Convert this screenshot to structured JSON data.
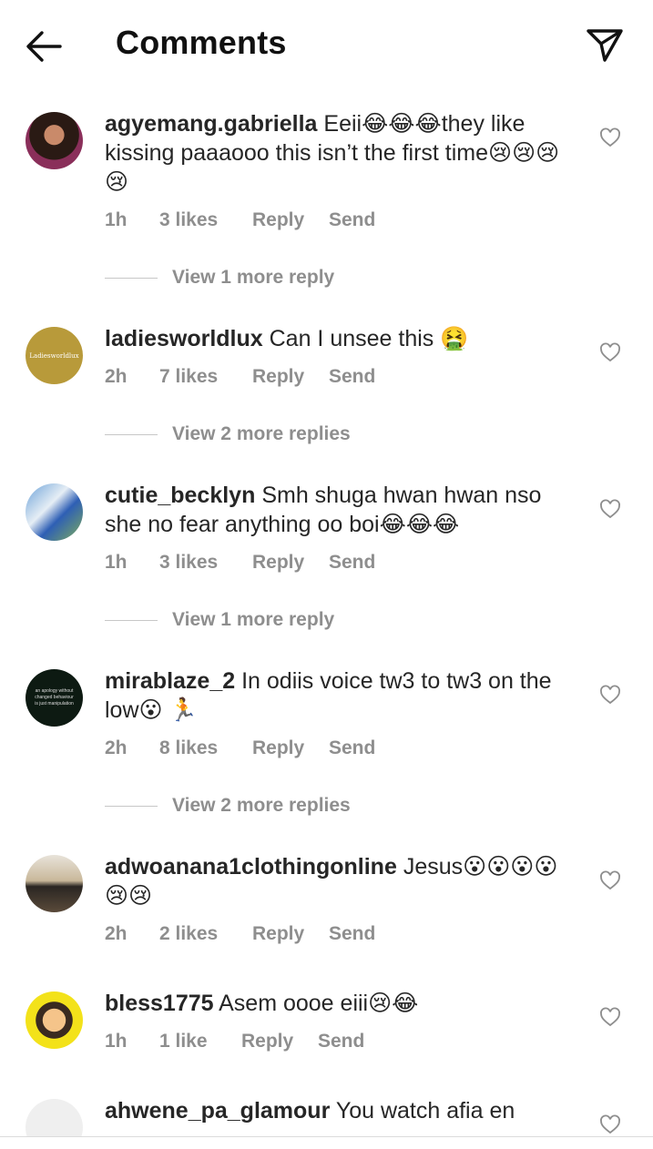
{
  "header": {
    "title": "Comments"
  },
  "comments": [
    {
      "username": "agyemang.gabriella",
      "text": "Eeii😂😂😂they like kissing paaaooo this isn’t the first time😢😢😢😢",
      "time": "1h",
      "likes": "3 likes",
      "reply": "Reply",
      "send": "Send",
      "view_replies": "View 1 more reply"
    },
    {
      "username": "ladiesworldlux",
      "text": "Can I unsee this 🤮",
      "avatar_text": "Ladiesworldlux",
      "time": "2h",
      "likes": "7 likes",
      "reply": "Reply",
      "send": "Send",
      "view_replies": "View 2 more replies"
    },
    {
      "username": "cutie_becklyn",
      "text": "Smh shuga hwan hwan nso she no fear anything oo boi😂😂😂",
      "time": "1h",
      "likes": "3 likes",
      "reply": "Reply",
      "send": "Send",
      "view_replies": "View 1 more reply"
    },
    {
      "username": "mirablaze_2",
      "text": "In odiis voice  tw3 to tw3 on the low😮 🏃",
      "avatar_text": "an apology without changed behaviour is just manipulation",
      "time": "2h",
      "likes": "8 likes",
      "reply": "Reply",
      "send": "Send",
      "view_replies": "View 2 more replies"
    },
    {
      "username": "adwoanana1clothingonline",
      "text": "Jesus😮😮😮😮😢😢",
      "time": "2h",
      "likes": "2 likes",
      "reply": "Reply",
      "send": "Send"
    },
    {
      "username": "bless1775",
      "text": "Asem oooe eiii😢😂",
      "time": "1h",
      "likes": "1 like",
      "reply": "Reply",
      "send": "Send"
    },
    {
      "username": "ahwene_pa_glamour",
      "text": "You watch afia en"
    }
  ]
}
